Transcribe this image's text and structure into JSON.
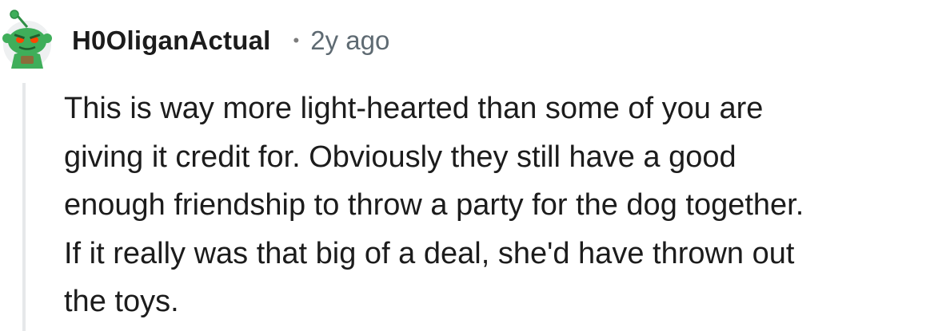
{
  "comment": {
    "author": "H0OliganActual",
    "separator": "•",
    "age": "2y ago",
    "body_lines": [
      "This is way more light-hearted than some of you are",
      "giving it credit for. Obviously they still have a good",
      "enough friendship to throw a party for the dog together.",
      "If it really was that big of a deal, she'd have thrown out",
      "the toys."
    ]
  },
  "avatar": {
    "icon": "snoo-avatar-icon",
    "colors": {
      "body": "#3fae5a",
      "eyes": "#ff4500",
      "antenna": "#3fae5a",
      "background": "#f2f3f4"
    }
  }
}
